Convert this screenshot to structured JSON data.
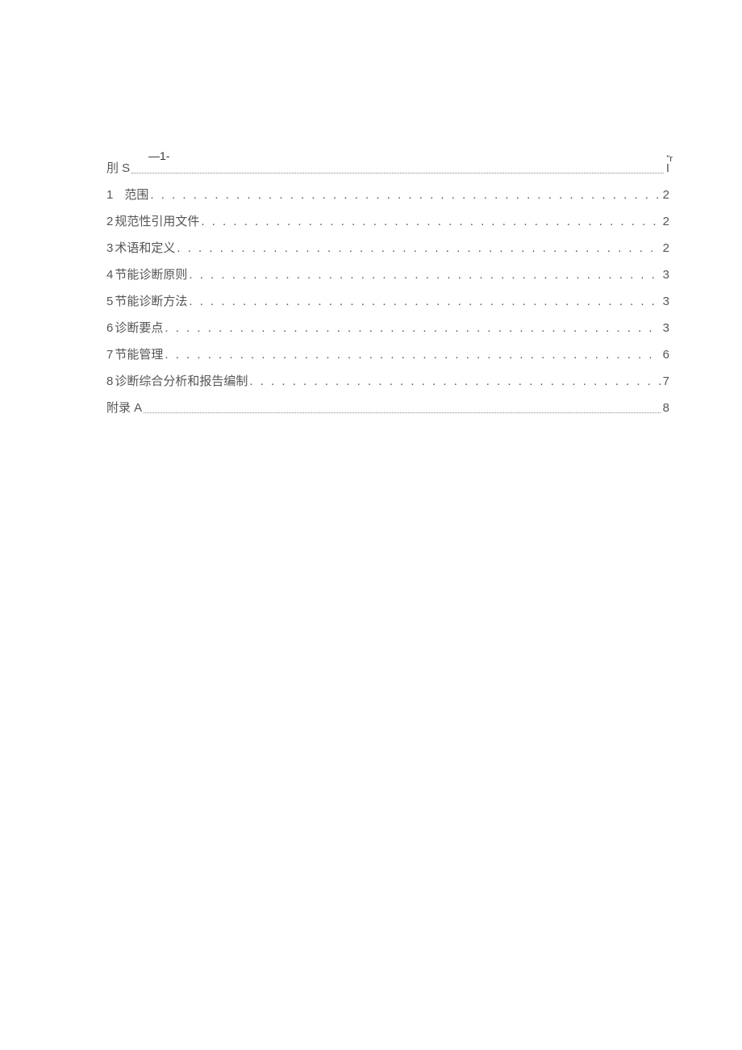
{
  "header": {
    "mark_left": "—1-",
    "mark_right": "\"r"
  },
  "toc": [
    {
      "num": "",
      "label": "刖 S",
      "page": "I",
      "style": "thin"
    },
    {
      "num": "1",
      "label": "范围",
      "page": "2",
      "style": "regular",
      "num_wide": true
    },
    {
      "num": "2",
      "label": "规范性引用文件",
      "page": "2",
      "style": "regular"
    },
    {
      "num": "3",
      "label": "术语和定义",
      "page": "2",
      "style": "regular"
    },
    {
      "num": "4",
      "label": "节能诊断原则",
      "page": "3",
      "style": "regular"
    },
    {
      "num": "5",
      "label": "节能诊断方法",
      "page": "3",
      "style": "regular"
    },
    {
      "num": "6",
      "label": "诊断要点",
      "page": "3",
      "style": "regular"
    },
    {
      "num": "7",
      "label": "节能管理",
      "page": "6",
      "style": "regular"
    },
    {
      "num": "8",
      "label": "诊断综合分析和报告编制",
      "page": "7",
      "style": "regular"
    },
    {
      "num": "",
      "label": "附录 A",
      "page": "8",
      "style": "thin"
    }
  ]
}
